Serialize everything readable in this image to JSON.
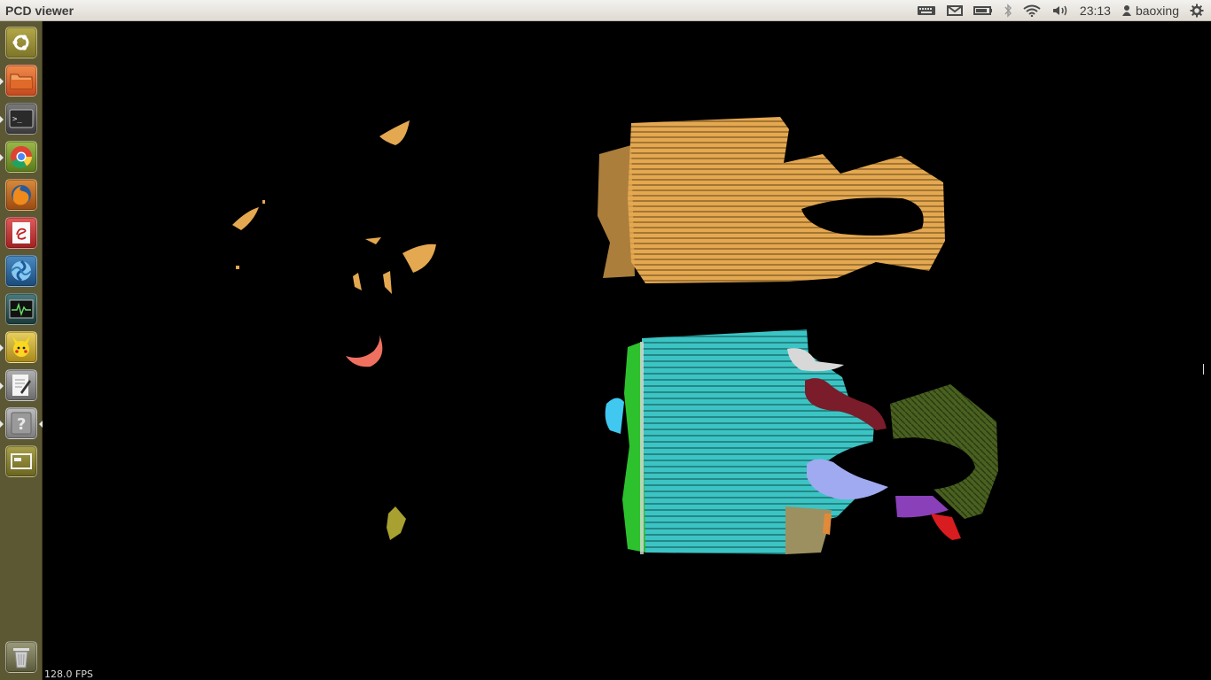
{
  "window": {
    "title": "PCD viewer"
  },
  "panel": {
    "indicators": [
      "keyboard-icon",
      "mail-icon",
      "battery-icon",
      "bluetooth-icon",
      "wifi-icon",
      "volume-icon"
    ],
    "clock": "23:13",
    "user": "baoxing",
    "session_icon": "gear-icon"
  },
  "launcher": {
    "items": [
      {
        "name": "dash-home",
        "icon": "ubuntu-logo-icon",
        "color": "#8a8a3a",
        "running": false
      },
      {
        "name": "files",
        "icon": "folder-icon",
        "color": "#e2622f",
        "running": true
      },
      {
        "name": "terminal",
        "icon": "terminal-icon",
        "color": "#3a3a3a",
        "running": true
      },
      {
        "name": "chrome",
        "icon": "chrome-icon",
        "color": "#7a9a2a",
        "running": true
      },
      {
        "name": "firefox",
        "icon": "firefox-icon",
        "color": "#c06a1c",
        "running": false
      },
      {
        "name": "ebook-reader",
        "icon": "reader-icon",
        "color": "#c33a3a",
        "running": false
      },
      {
        "name": "shutter",
        "icon": "swirl-icon",
        "color": "#2a6a9a",
        "running": false
      },
      {
        "name": "system-monitor",
        "icon": "monitor-icon",
        "color": "#2a5a5a",
        "running": false
      },
      {
        "name": "pikachu-app",
        "icon": "pikachu-icon",
        "color": "#c8a830",
        "running": true
      },
      {
        "name": "text-editor",
        "icon": "editor-icon",
        "color": "#8a8a8a",
        "running": true
      },
      {
        "name": "help",
        "icon": "help-icon",
        "color": "#8a8a8a",
        "running": true,
        "focused": true
      },
      {
        "name": "workspace-switcher",
        "icon": "workspace-icon",
        "color": "#8a8a3a",
        "running": false
      },
      {
        "name": "trash",
        "icon": "trash-icon",
        "color": "#7a7a5a",
        "running": false
      }
    ]
  },
  "viewer": {
    "fps": "128.0 FPS",
    "colors": {
      "orange": "#e4a850",
      "cyan": "#3cc4c4",
      "green": "#2ec12e",
      "dark_green": "#4a6020",
      "maroon": "#7a1c2a",
      "light_blue": "#a0aaf0",
      "purple": "#8a40b8",
      "red": "#d81c20",
      "khaki": "#9c9060",
      "white": "#d8d8d8",
      "salmon": "#f07060",
      "olive": "#a8a030",
      "sky": "#40c8f0"
    }
  }
}
